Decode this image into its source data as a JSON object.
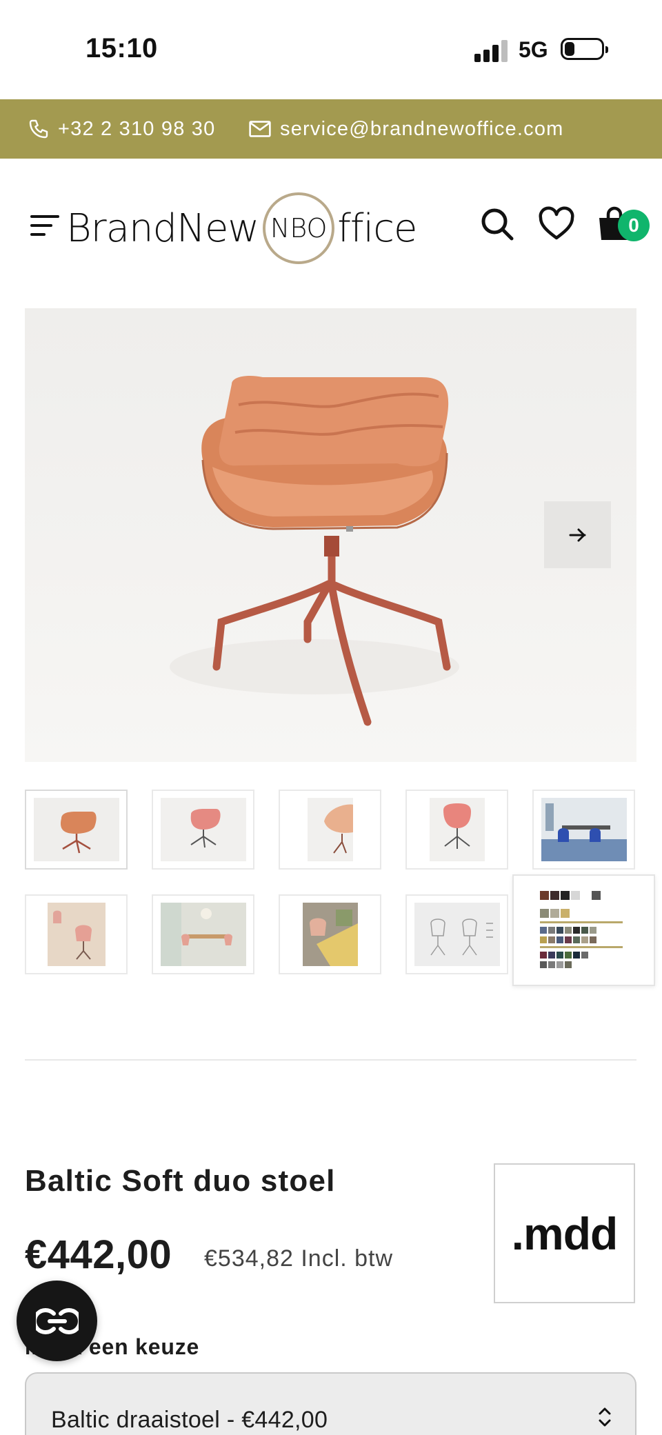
{
  "status_bar": {
    "time": "15:10",
    "network": "5G"
  },
  "contact_bar": {
    "phone": "+32 2 310 98 30",
    "email": "service@brandnewoffice.com",
    "background": "#a39a50"
  },
  "header": {
    "logo_left": "BrandNew",
    "logo_mark": "NBO",
    "logo_right": "ffice",
    "cart_count": "0",
    "badge_color": "#10b56c"
  },
  "gallery": {
    "thumbnails": [
      "Baltic Soft duo stoel oranje",
      "Baltic Soft duo stoel roze",
      "Baltic Soft duo stoel detail",
      "Baltic Soft duo stoel roze vooraanzicht",
      "Baltic Soft duo stoel kantoor",
      "Baltic Soft duo stoelen sfeer",
      "Baltic Soft duo stoelen vergaderruimte",
      "Baltic Soft duo stoel terras",
      "Baltic Soft duo stoel afmetingen",
      "Baltic Soft duo stoel kleurstalen"
    ]
  },
  "product": {
    "title": "Baltic Soft duo stoel",
    "price": "€442,00",
    "price_incl": "€534,82 Incl. btw",
    "brand": ".mdd",
    "choose_label": "Maak een keuze",
    "selected_option": "Baltic draaistoel - €442,00"
  }
}
